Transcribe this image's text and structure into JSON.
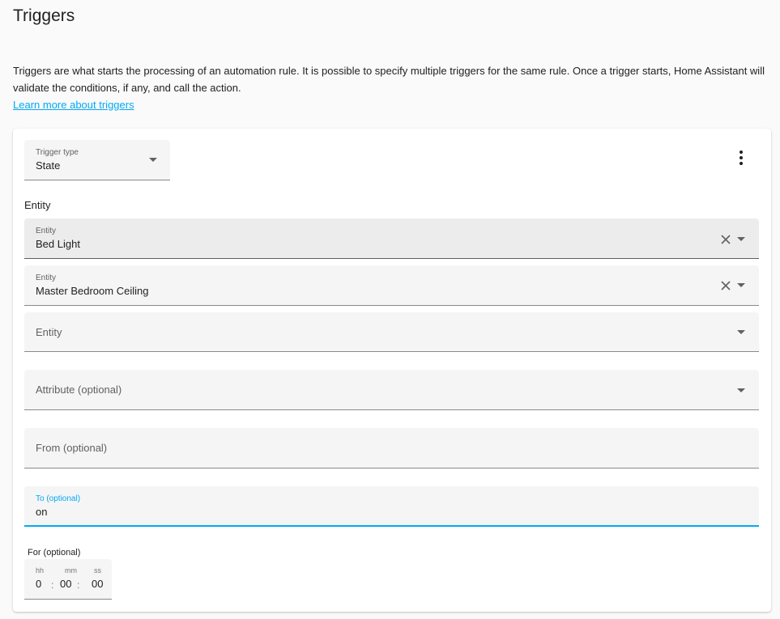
{
  "page": {
    "title": "Triggers",
    "description": "Triggers are what starts the processing of an automation rule. It is possible to specify multiple triggers for the same rule. Once a trigger starts, Home Assistant will validate the conditions, if any, and call the action.",
    "learn_more": "Learn more about triggers"
  },
  "trigger": {
    "type_label": "Trigger type",
    "type_value": "State",
    "menu_icon": "dots-vertical-icon",
    "entity_section_label": "Entity",
    "entities": [
      {
        "label": "Entity",
        "value": "Bed Light"
      },
      {
        "label": "Entity",
        "value": "Master Bedroom Ceiling"
      }
    ],
    "entity_empty_placeholder": "Entity",
    "attribute_placeholder": "Attribute (optional)",
    "from_placeholder": "From (optional)",
    "to_label": "To (optional)",
    "to_value": "on",
    "for_label": "For (optional)",
    "duration": {
      "hh_label": "hh",
      "mm_label": "mm",
      "ss_label": "ss",
      "hh": "0",
      "mm": "00",
      "ss": "00",
      "separator": ":"
    }
  },
  "colors": {
    "accent": "#03a9f4",
    "field_bg": "#f5f5f5",
    "card_bg": "#ffffff",
    "page_bg": "#fafafa"
  }
}
